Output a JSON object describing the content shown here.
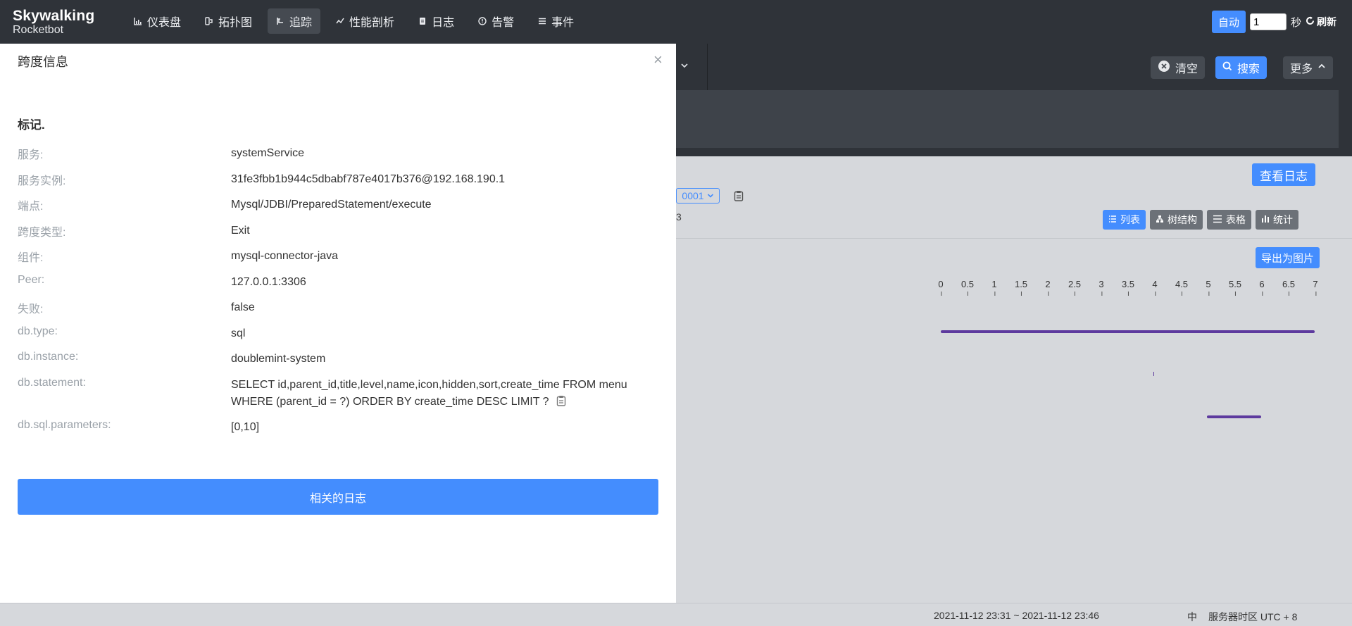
{
  "logo": {
    "line1": "Skywalking",
    "line2": "Rocketbot"
  },
  "nav": [
    {
      "label": "仪表盘",
      "icon": "chart-icon"
    },
    {
      "label": "拓扑图",
      "icon": "topology-icon"
    },
    {
      "label": "追踪",
      "icon": "trace-icon",
      "active": true
    },
    {
      "label": "性能剖析",
      "icon": "profile-icon"
    },
    {
      "label": "日志",
      "icon": "log-icon"
    },
    {
      "label": "告警",
      "icon": "alarm-icon"
    },
    {
      "label": "事件",
      "icon": "event-icon"
    }
  ],
  "topright": {
    "auto": "自动",
    "seconds_value": "1",
    "seconds_label": "秒",
    "refresh": "刷新"
  },
  "toolbar": {
    "clear": "清空",
    "search": "搜索",
    "more": "更多"
  },
  "trace": {
    "view_logs": "查看日志",
    "trace_id_fragment": "0001",
    "fragment": "3",
    "views": {
      "list": "列表",
      "tree": "树结构",
      "table": "表格",
      "stats": "统计"
    },
    "export": "导出为图片",
    "axis_ticks": [
      "0",
      "0.5",
      "1",
      "1.5",
      "2",
      "2.5",
      "3",
      "3.5",
      "4",
      "4.5",
      "5",
      "5.5",
      "6",
      "6.5",
      "7"
    ]
  },
  "footer": {
    "time_range": "2021-11-12 23:31 ~ 2021-11-12 23:46",
    "lang": "中",
    "timezone": "服务器时区 UTC + 8"
  },
  "drawer": {
    "title": "跨度信息",
    "section": "标记.",
    "rows": [
      {
        "key": "服务:",
        "value": "systemService"
      },
      {
        "key": "服务实例:",
        "value": "31fe3fbb1b944c5dbabf787e4017b376@192.168.190.1"
      },
      {
        "key": "端点:",
        "value": "Mysql/JDBI/PreparedStatement/execute"
      },
      {
        "key": "跨度类型:",
        "value": "Exit"
      },
      {
        "key": "组件:",
        "value": "mysql-connector-java"
      },
      {
        "key": "Peer:",
        "value": "127.0.0.1:3306"
      },
      {
        "key": "失败:",
        "value": "false"
      },
      {
        "key": "db.type:",
        "value": "sql"
      },
      {
        "key": "db.instance:",
        "value": "doublemint-system"
      },
      {
        "key": "db.statement:",
        "value": "SELECT id,parent_id,title,level,name,icon,hidden,sort,create_time FROM menu WHERE (parent_id = ?) ORDER BY create_time DESC LIMIT ?"
      },
      {
        "key": "db.sql.parameters:",
        "value": "[0,10]"
      }
    ],
    "related_logs": "相关的日志"
  }
}
